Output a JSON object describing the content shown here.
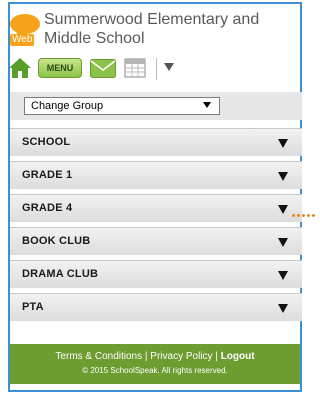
{
  "header": {
    "school_name": "Summerwood Elementary and Middle School",
    "logo_web": "Web"
  },
  "toolbar": {
    "menu_label": "MENU",
    "icons": [
      "home-icon",
      "mail-icon",
      "calendar-icon",
      "dropdown-arrow-icon"
    ]
  },
  "group_select": {
    "value": "Change Group"
  },
  "groups": [
    {
      "label": "SCHOOL"
    },
    {
      "label": "GRADE 1"
    },
    {
      "label": "GRADE 4"
    },
    {
      "label": "BOOK CLUB"
    },
    {
      "label": "DRAMA CLUB"
    },
    {
      "label": "PTA"
    }
  ],
  "footer": {
    "terms": "Terms & Conditions",
    "sep1": " | ",
    "privacy": "Privacy Policy",
    "sep2": " | ",
    "logout": "Logout",
    "copyright": "© 2015 SchoolSpeak. All rights reserved."
  },
  "colors": {
    "frame_border": "#3d8fd6",
    "accent_orange": "#f7a21b",
    "footer_green": "#6d9d31",
    "menu_green": "#8bc34a"
  }
}
